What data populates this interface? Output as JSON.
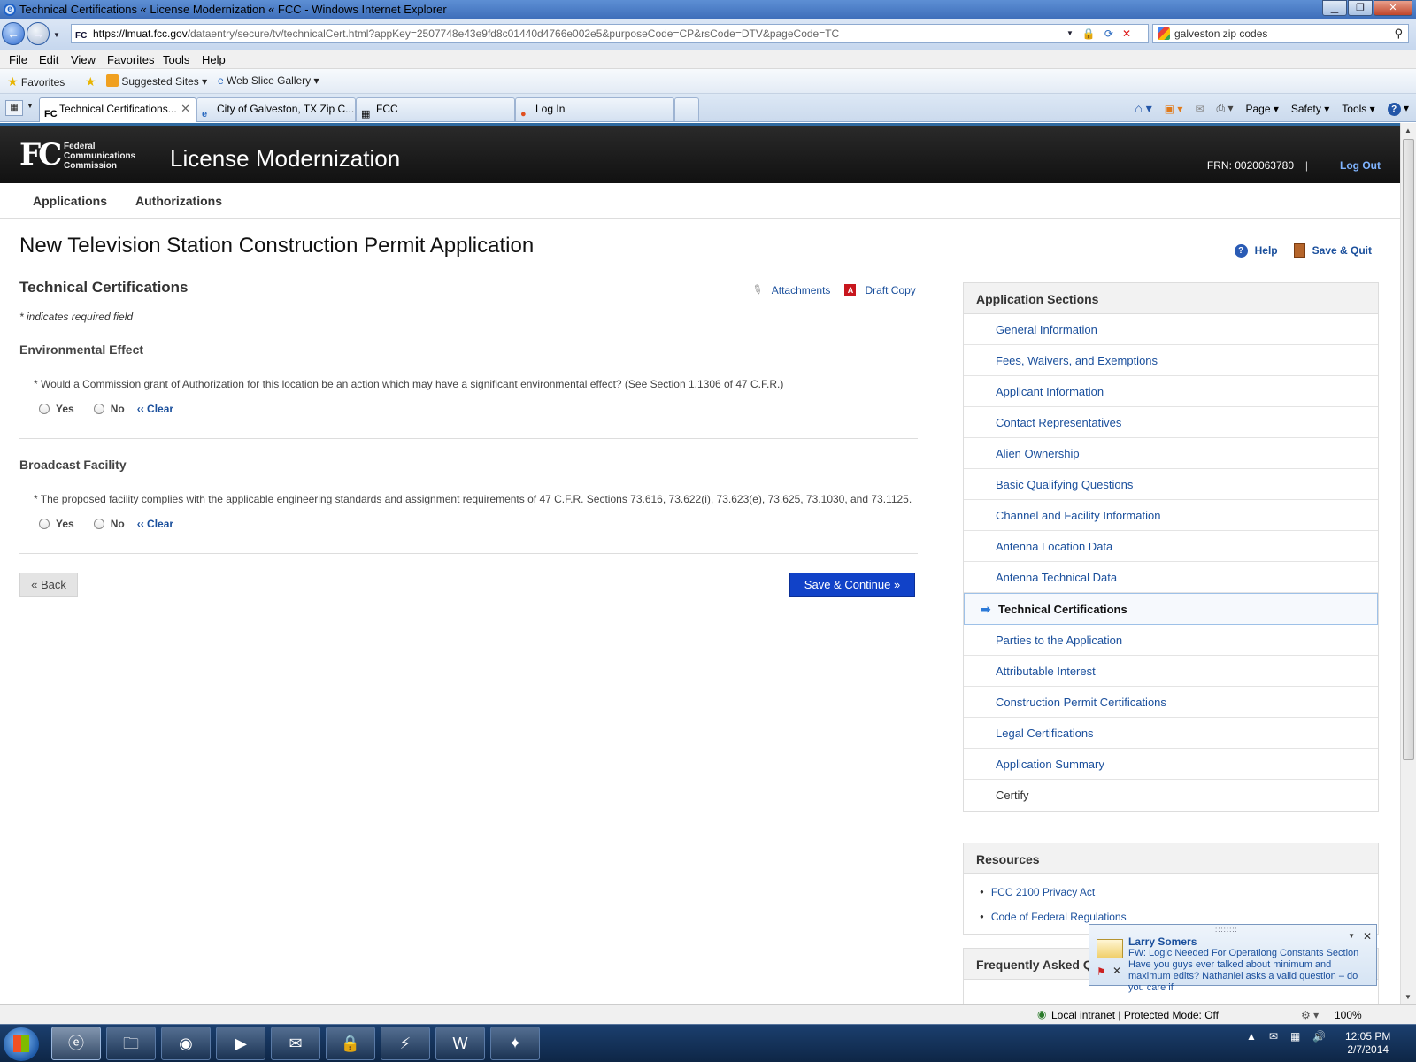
{
  "window": {
    "title": "Technical Certifications « License Modernization « FCC - Windows Internet Explorer",
    "url_host": "https://lmuat.fcc.gov",
    "url_rest": "/dataentry/secure/tv/technicalCert.html?appKey=2507748e43e9fd8c01440d4766e002e5&purposeCode=CP&rsCode=DTV&pageCode=TC",
    "search_value": "galveston zip codes"
  },
  "menu": [
    "File",
    "Edit",
    "View",
    "Favorites",
    "Tools",
    "Help"
  ],
  "favorites_bar": {
    "favorites": "Favorites",
    "suggested": "Suggested Sites",
    "webslice": "Web Slice Gallery"
  },
  "tabs": [
    {
      "label": "Technical Certifications...",
      "icon": "FC"
    },
    {
      "label": "City of Galveston, TX Zip C...",
      "icon": "e"
    },
    {
      "label": "FCC",
      "icon": "▦"
    },
    {
      "label": "Log In",
      "icon": "●"
    }
  ],
  "command_bar": {
    "page": "Page",
    "safety": "Safety",
    "tools": "Tools"
  },
  "header": {
    "logo": "FC",
    "agency_line1": "Federal",
    "agency_line2": "Communications",
    "agency_line3": "Commission",
    "app_title": "License Modernization",
    "frn": "FRN: 0020063780",
    "separator": "|",
    "logout": "Log Out"
  },
  "main_nav": [
    "Applications",
    "Authorizations"
  ],
  "page": {
    "title": "New Television Station Construction Permit Application",
    "help": "Help",
    "save_quit": "Save & Quit",
    "section_title": "Technical Certifications",
    "attachments": "Attachments",
    "draft_copy": "Draft Copy",
    "required_note": "* indicates required field",
    "environmental": {
      "heading": "Environmental Effect",
      "question": "* Would a Commission grant of Authorization for this location be an action which may have a significant environmental effect? (See Section 1.1306 of 47 C.F.R.)",
      "yes": "Yes",
      "no": "No",
      "clear": "‹‹ Clear"
    },
    "broadcast": {
      "heading": "Broadcast Facility",
      "question": "* The proposed facility complies with the applicable engineering standards and assignment requirements of 47 C.F.R. Sections 73.616, 73.622(i), 73.623(e), 73.625, 73.1030, and 73.1125.",
      "yes": "Yes",
      "no": "No",
      "clear": "‹‹ Clear"
    },
    "back_label": "« Back",
    "save_continue_label": "Save & Continue »"
  },
  "sidebar": {
    "heading": "Application Sections",
    "items": [
      "General Information",
      "Fees, Waivers, and Exemptions",
      "Applicant Information",
      "Contact Representatives",
      "Alien Ownership",
      "Basic Qualifying Questions",
      "Channel and Facility Information",
      "Antenna Location Data",
      "Antenna Technical Data",
      "Technical Certifications",
      "Parties to the Application",
      "Attributable Interest",
      "Construction Permit Certifications",
      "Legal Certifications",
      "Application Summary",
      "Certify"
    ],
    "active_index": 9
  },
  "resources": {
    "heading": "Resources",
    "items": [
      "FCC 2100 Privacy Act",
      "Code of Federal Regulations"
    ]
  },
  "faq": {
    "heading": "Frequently Asked Questions"
  },
  "notification": {
    "sender": "Larry Somers",
    "message": "FW: Logic Needed For Operationg Constants Section Have you guys ever talked about minimum and maximum edits? Nathaniel asks a valid question – do you care if"
  },
  "statusbar": {
    "zone": "Local intranet | Protected Mode: Off",
    "zoom": "100%"
  },
  "clock": {
    "time": "12:05 PM",
    "date": "2/7/2014"
  }
}
